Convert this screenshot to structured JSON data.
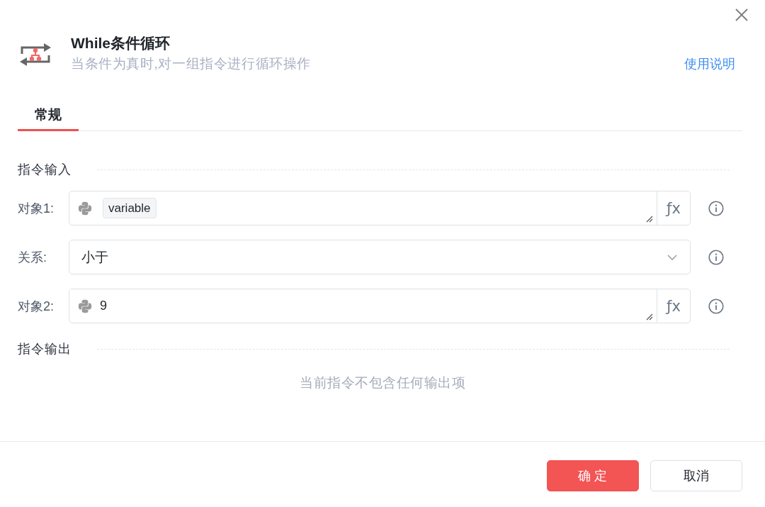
{
  "header": {
    "title": "While条件循环",
    "subtitle": "当条件为真时,对一组指令进行循环操作",
    "help_link": "使用说明"
  },
  "tabs": [
    {
      "label": "常规",
      "selected": true
    }
  ],
  "input_section": {
    "title": "指令输入",
    "fields": [
      {
        "kind": "expression",
        "label": "对象1:",
        "value": {
          "kind": "variable",
          "text": "variable"
        },
        "function_button": "ƒx"
      },
      {
        "kind": "select",
        "label": "关系:",
        "value": {
          "kind": "literal",
          "text": "小于"
        }
      },
      {
        "kind": "expression",
        "label": "对象2:",
        "value": {
          "kind": "literal",
          "text": "9"
        },
        "function_button": "ƒx"
      }
    ]
  },
  "output_section": {
    "title": "指令输出",
    "empty_text": "当前指令不包含任何输出项"
  },
  "buttons": [
    {
      "label": "确 定",
      "kind": "primary"
    },
    {
      "label": "取消",
      "kind": "secondary"
    }
  ]
}
